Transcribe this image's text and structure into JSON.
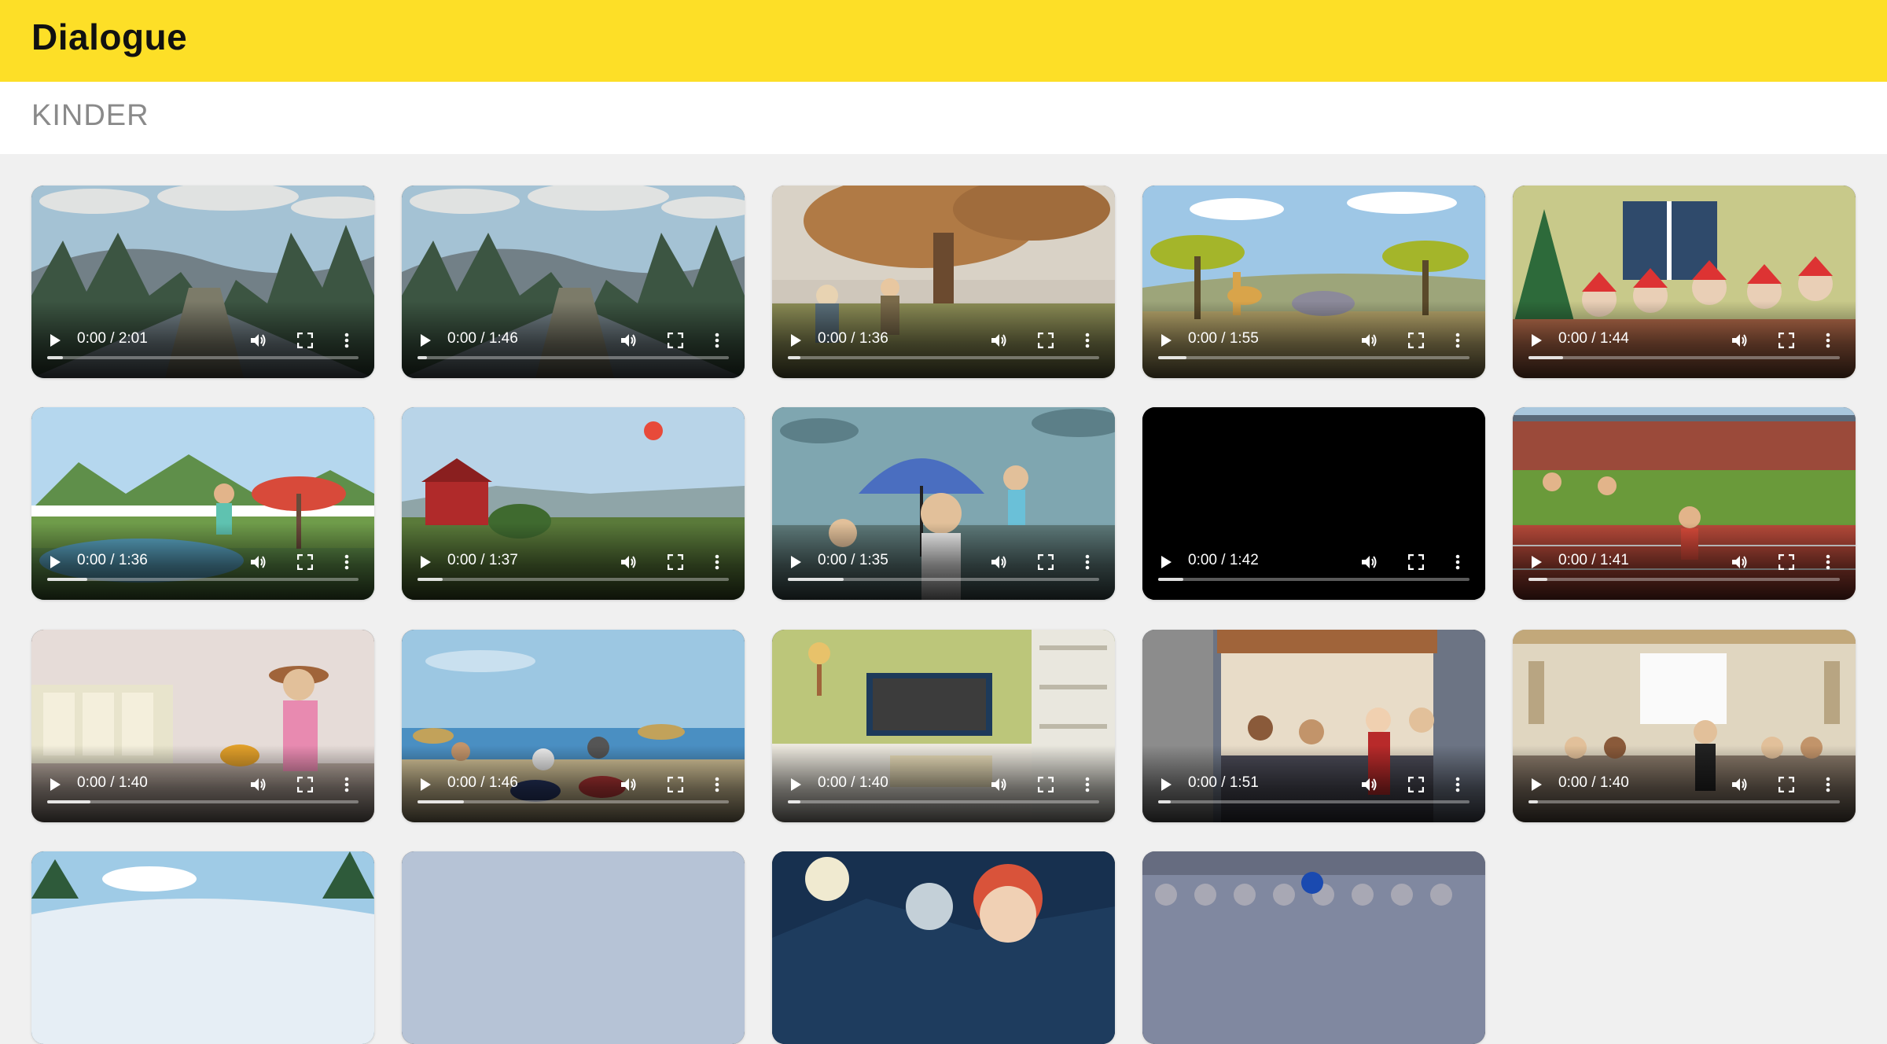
{
  "app": {
    "title": "Dialogue"
  },
  "section": {
    "title": "KINDER"
  },
  "colors": {
    "header": "#fddf27",
    "background": "#f0f0f0"
  },
  "videos": [
    {
      "id": "forest-road-car",
      "time": "0:00 / 2:01",
      "buffered": 0.05,
      "scene": "forest-road"
    },
    {
      "id": "forest-road",
      "time": "0:00 / 1:46",
      "buffered": 0.03,
      "scene": "forest-road"
    },
    {
      "id": "autumn-birdwatching",
      "time": "0:00 / 1:36",
      "buffered": 0.04,
      "scene": "autumn"
    },
    {
      "id": "savanna-animals",
      "time": "0:00 / 1:55",
      "buffered": 0.09,
      "scene": "savanna"
    },
    {
      "id": "christmas-dinner",
      "time": "0:00 / 1:44",
      "buffered": 0.11,
      "scene": "christmas"
    },
    {
      "id": "pool-party",
      "time": "0:00 / 1:36",
      "buffered": 0.13,
      "scene": "pool"
    },
    {
      "id": "red-barn-farm",
      "time": "0:00 / 1:37",
      "buffered": 0.08,
      "scene": "farm"
    },
    {
      "id": "rainy-umbrella",
      "time": "0:00 / 1:35",
      "buffered": 0.18,
      "scene": "rain"
    },
    {
      "id": "black-video",
      "time": "0:00 / 1:42",
      "buffered": 0.08,
      "scene": "black"
    },
    {
      "id": "running-track",
      "time": "0:00 / 1:41",
      "buffered": 0.06,
      "scene": "track"
    },
    {
      "id": "shop-cowboy-hat",
      "time": "0:00 / 1:40",
      "buffered": 0.14,
      "scene": "shop"
    },
    {
      "id": "beach-motorbikes",
      "time": "0:00 / 1:46",
      "buffered": 0.15,
      "scene": "beach"
    },
    {
      "id": "living-room-tv",
      "time": "0:00 / 1:40",
      "buffered": 0.04,
      "scene": "livingroom"
    },
    {
      "id": "cafe-street",
      "time": "0:00 / 1:51",
      "buffered": 0.04,
      "scene": "cafe"
    },
    {
      "id": "banquet-hall",
      "time": "0:00 / 1:40",
      "buffered": 0.03,
      "scene": "banquet"
    },
    {
      "id": "snowy-mountains",
      "time": "",
      "buffered": 0,
      "scene": "snow"
    },
    {
      "id": "pale-sky",
      "time": "",
      "buffered": 0,
      "scene": "pale"
    },
    {
      "id": "night-moon-woman",
      "time": "",
      "buffered": 0,
      "scene": "night"
    },
    {
      "id": "stadium-crowd",
      "time": "",
      "buffered": 0,
      "scene": "stadium"
    }
  ]
}
